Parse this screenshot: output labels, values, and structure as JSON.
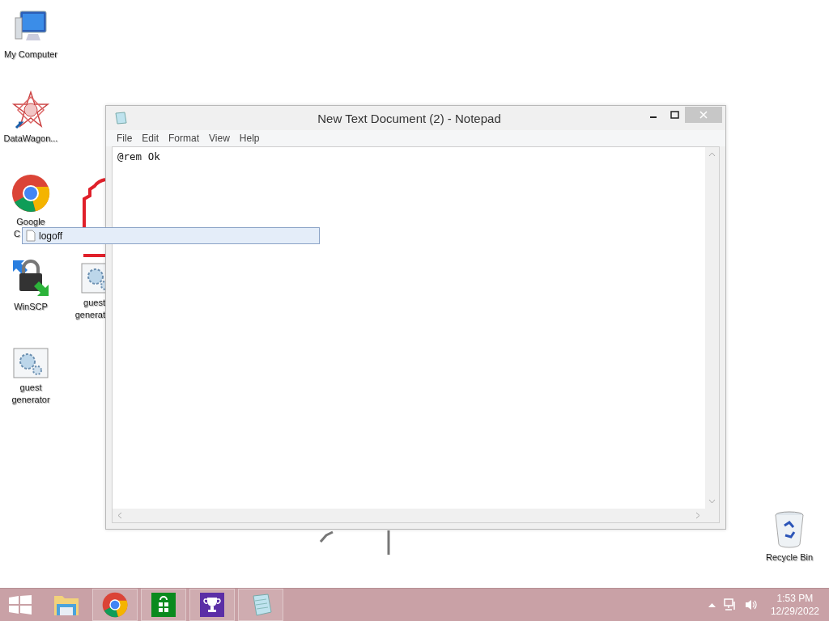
{
  "desktop_icons": [
    {
      "kind": "computer",
      "label_lines": [
        "My Computer"
      ]
    },
    {
      "kind": "datawagon",
      "label_lines": [
        "DataWagon..."
      ]
    },
    {
      "kind": "chrome",
      "label_lines": [
        "Google",
        "C"
      ]
    },
    {
      "kind": "winscp",
      "label_lines": [
        "WinSCP"
      ]
    },
    {
      "kind": "gear",
      "label_lines": [
        "guest",
        "generat"
      ]
    },
    {
      "kind": "gear",
      "label_lines": [
        "guest",
        "generator"
      ]
    },
    {
      "kind": "recycle",
      "label_lines": [
        "Recycle Bin"
      ]
    }
  ],
  "drag_tooltip": {
    "text": "logoff"
  },
  "window": {
    "title": "New Text Document (2) - Notepad",
    "menu": [
      "File",
      "Edit",
      "Format",
      "View",
      "Help"
    ],
    "text": "@rem Ok"
  },
  "taskbar": {
    "items": [
      {
        "kind": "start",
        "running": false
      },
      {
        "kind": "explorer",
        "running": false
      },
      {
        "kind": "chrome",
        "running": true
      },
      {
        "kind": "store",
        "running": true
      },
      {
        "kind": "trophy",
        "running": true
      },
      {
        "kind": "notepad",
        "running": true
      }
    ],
    "clock": {
      "time": "1:53 PM",
      "date": "12/29/2022"
    }
  }
}
